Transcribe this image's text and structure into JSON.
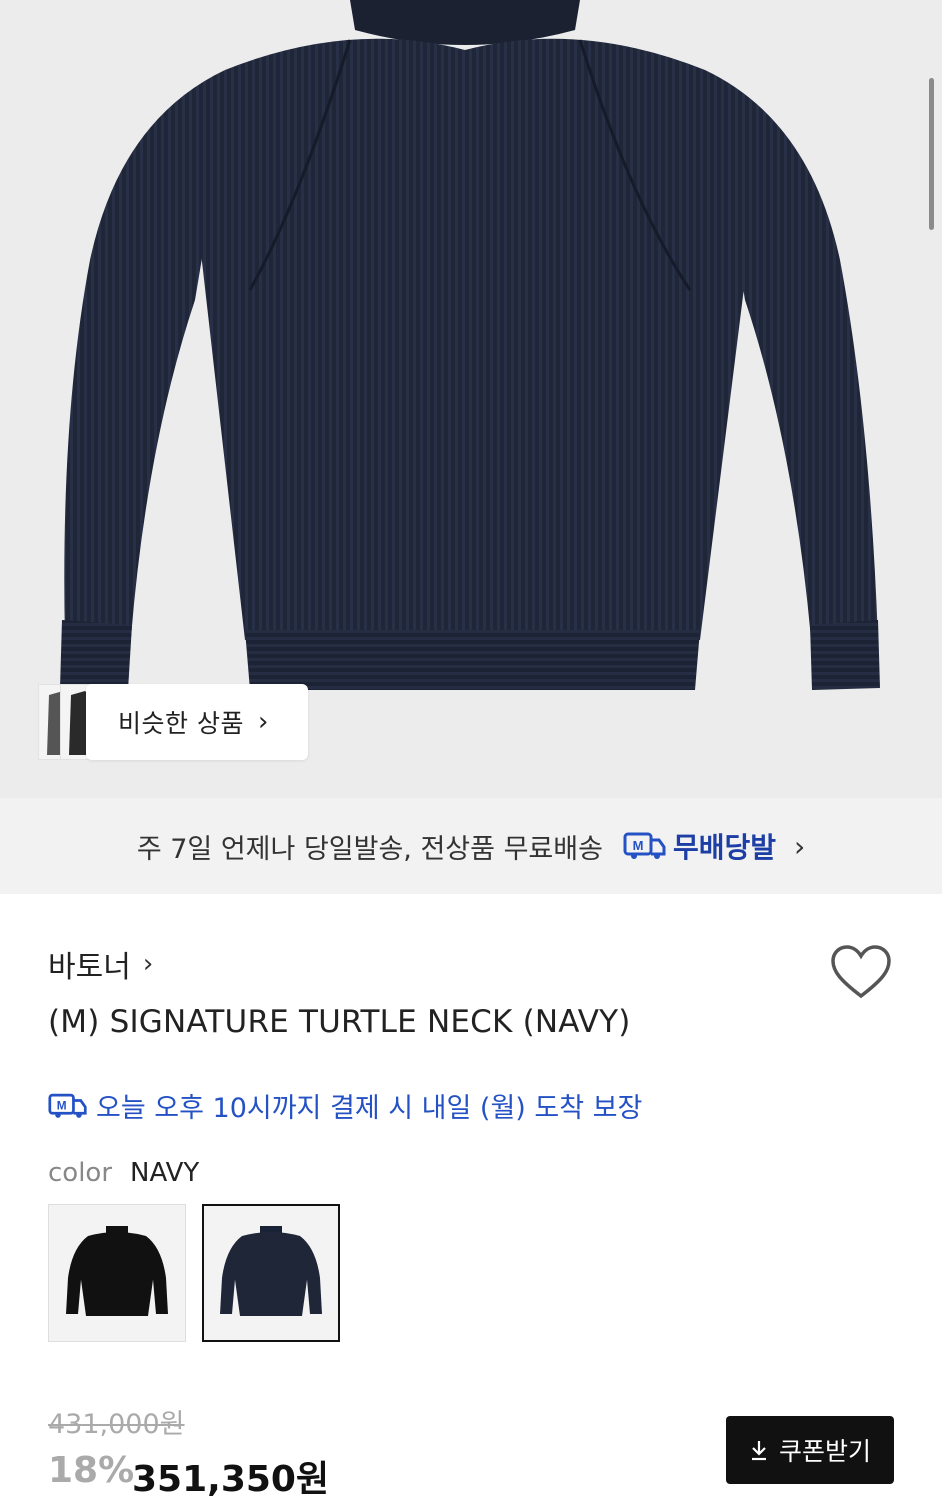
{
  "hero": {
    "image_subject": "navy ribbed knit sweater",
    "similar_button_label": "비슷한 상품"
  },
  "banner": {
    "text": "주 7일 언제나 당일발송, 전상품 무료배송",
    "badge_label": "무배당발"
  },
  "product": {
    "brand": "바토너",
    "title": "(M) SIGNATURE TURTLE NECK (NAVY)",
    "delivery_promise": "오늘 오후 10시까지 결제 시 내일 (월) 도착 보장",
    "color_label": "color",
    "color_value": "NAVY",
    "original_price": "431,000원",
    "discount": "18%",
    "sale_price": "351,350원",
    "coupon_label": "쿠폰받기"
  },
  "colors": {
    "accent_blue": "#2452c5",
    "navy_sweater": "#1f2638",
    "black_sweater": "#111111"
  },
  "icons": {
    "heart": "heart-icon",
    "delivery": "delivery-truck-icon",
    "download": "download-icon",
    "chevron": "chevron-right-icon"
  }
}
